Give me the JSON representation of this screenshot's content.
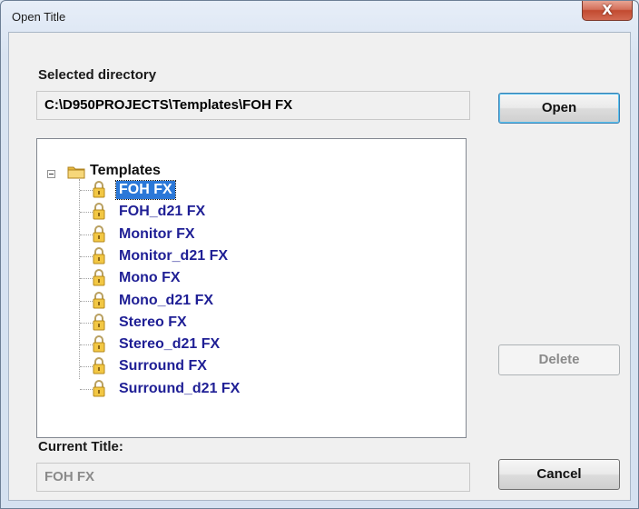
{
  "window": {
    "title": "Open Title",
    "close_label": "X"
  },
  "selected_directory": {
    "label": "Selected directory",
    "value": "C:\\D950PROJECTS\\Templates\\FOH FX"
  },
  "tree": {
    "root": "Templates",
    "items": [
      {
        "label": "FOH FX",
        "selected": true
      },
      {
        "label": "FOH_d21 FX"
      },
      {
        "label": "Monitor FX"
      },
      {
        "label": "Monitor_d21 FX"
      },
      {
        "label": "Mono FX"
      },
      {
        "label": "Mono_d21 FX"
      },
      {
        "label": "Stereo FX"
      },
      {
        "label": "Stereo_d21 FX"
      },
      {
        "label": "Surround FX"
      },
      {
        "label": "Surround_d21 FX"
      }
    ],
    "item_icon": "lock-icon",
    "root_icon": "folder-icon"
  },
  "buttons": {
    "open": "Open",
    "delete": "Delete",
    "cancel": "Cancel"
  },
  "current_title": {
    "label": "Current Title:",
    "value": "FOH FX"
  },
  "colors": {
    "item_text": "#1f1f95",
    "selection": "#2b78d8"
  }
}
